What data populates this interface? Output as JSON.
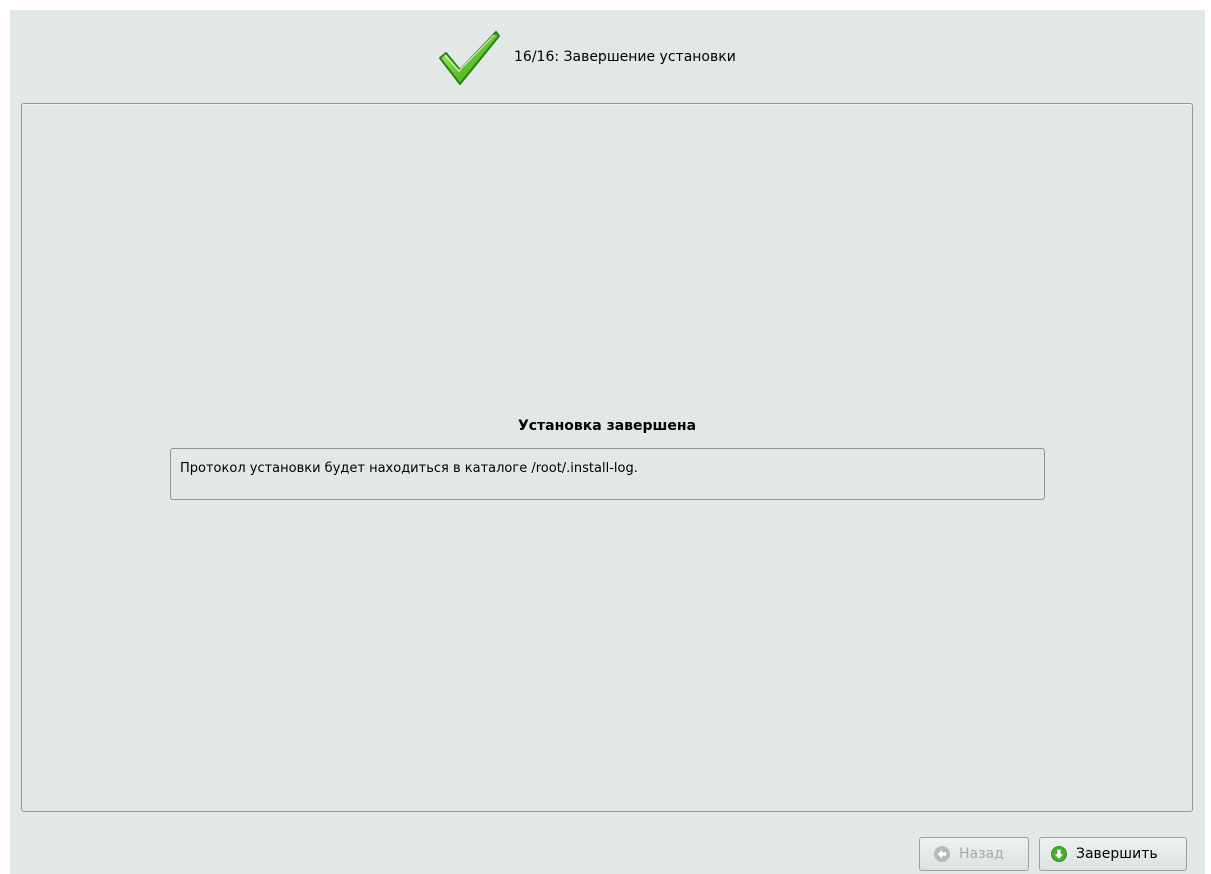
{
  "header": {
    "step_title": "16/16: Завершение установки",
    "icon": "check-icon"
  },
  "main": {
    "heading": "Установка завершена",
    "log_message": "Протокол установки будет находиться в каталоге /root/.install-log."
  },
  "buttons": {
    "back_label": "Назад",
    "back_icon": "arrow-left-icon",
    "finish_label": "Завершить",
    "finish_icon": "arrow-down-icon"
  },
  "colors": {
    "background": "#e1e8e6",
    "accent_green": "#36a21f",
    "disabled_text": "#a3aaa8"
  }
}
